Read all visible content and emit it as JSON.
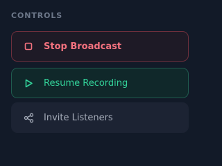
{
  "controls": {
    "section_label": "CONTROLS",
    "items": [
      {
        "label": "Stop Broadcast",
        "icon": "stop-square-icon",
        "color": "#f4727f"
      },
      {
        "label": "Resume Recording",
        "icon": "play-triangle-icon",
        "color": "#33d39a"
      },
      {
        "label": "Invite Listeners",
        "icon": "share-nodes-icon",
        "color": "#a6adba"
      }
    ]
  }
}
